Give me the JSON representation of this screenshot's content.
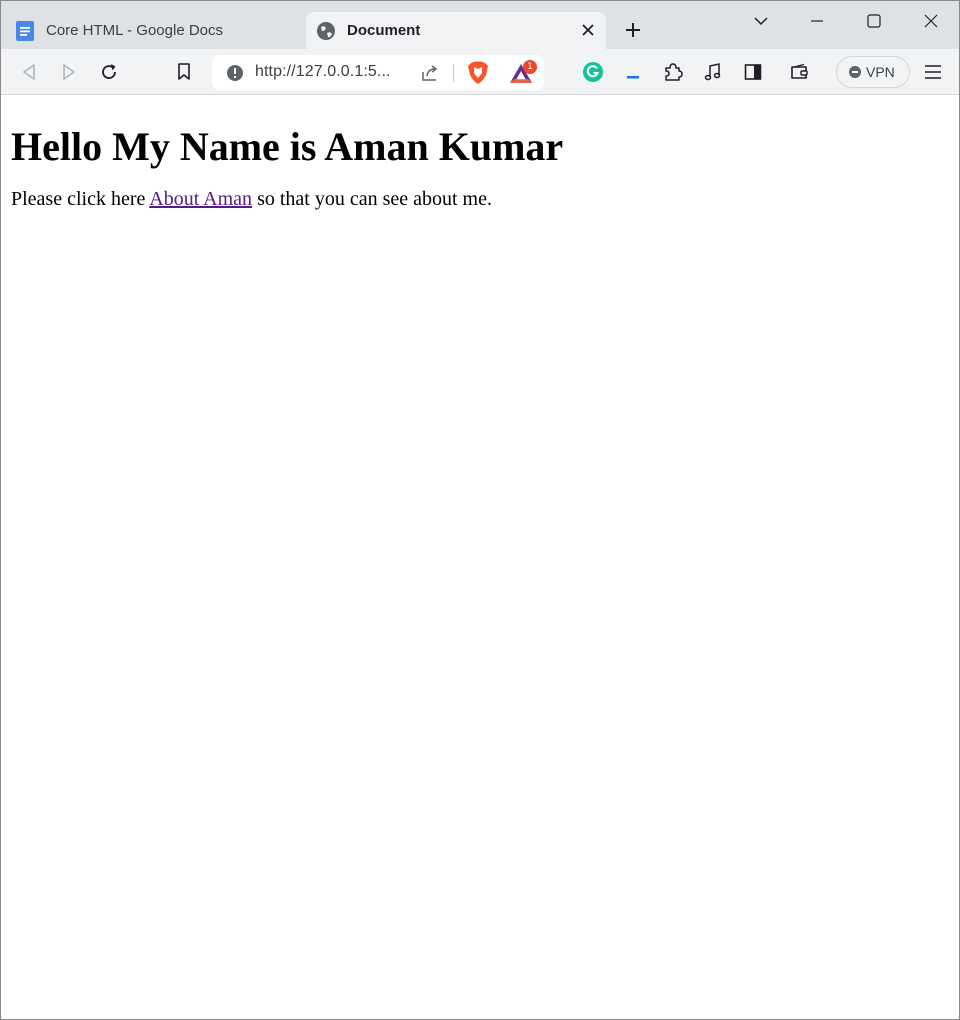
{
  "browser": {
    "tabs": [
      {
        "title": "Core HTML - Google Docs",
        "icon": "google-docs-icon",
        "active": false
      },
      {
        "title": "Document",
        "icon": "globe-icon",
        "active": true
      }
    ],
    "address_bar": {
      "url": "http://127.0.0.1:5..."
    },
    "rewards_badge": "1",
    "vpn_label": "VPN"
  },
  "page": {
    "heading": "Hello My Name is Aman Kumar",
    "paragraph_before": "Please click here ",
    "link_text": "About Aman",
    "paragraph_after": " so that you can see about me."
  },
  "colors": {
    "tabstrip": "#dee1e6",
    "toolbar": "#f1f3f4",
    "visited_link": "#551a8b",
    "brave_orange": "#fb542b",
    "grammarly_green": "#15c39a"
  }
}
